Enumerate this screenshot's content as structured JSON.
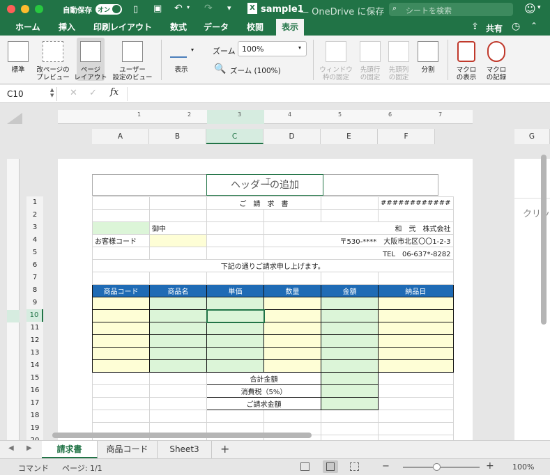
{
  "titlebar": {
    "autosave_label": "自動保存",
    "autosave_state": "オン",
    "title": "sample1",
    "title_suffix": "— OneDrive に保存",
    "search_placeholder": "シートを検索"
  },
  "tabs": [
    "ホーム",
    "挿入",
    "印刷レイアウト",
    "数式",
    "データ",
    "校閲",
    "表示"
  ],
  "share_label": "共有",
  "ribbon": {
    "normal": "標準",
    "pagebreak": "改ページの\nプレビュー",
    "pagelayout": "ページ\nレイアウト",
    "custom": "ユーザー\n設定のビュー",
    "show": "表示",
    "zoom_label": "ズーム",
    "zoom_value": "100%",
    "zoom100": "ズーム (100%)",
    "freeze": "ウィンドウ\n枠の固定",
    "freeze_row": "先頭行\nの固定",
    "freeze_col": "先頭列\nの固定",
    "split": "分割",
    "macro_view": "マクロ\nの表示",
    "macro_record": "マクロ\nの記録"
  },
  "formula": {
    "namebox": "C10",
    "fx": "fx",
    "value": ""
  },
  "columns": [
    "A",
    "B",
    "C",
    "D",
    "E",
    "F"
  ],
  "col_g": "G",
  "ruler_numbers": [
    "1",
    "2",
    "3",
    "4",
    "5",
    "6",
    "7"
  ],
  "header_add": "ヘッダーの追加",
  "right_page_text": "クリッ",
  "rows": [
    {
      "n": "1",
      "cells": [
        "",
        "",
        "ご　請　求　書",
        "",
        "",
        "############"
      ]
    },
    {
      "n": "2",
      "cells": [
        "",
        "",
        "",
        "",
        "",
        ""
      ]
    },
    {
      "n": "3",
      "cells": [
        "",
        "御中",
        "",
        "和　弐　株式会社",
        "",
        ""
      ]
    },
    {
      "n": "4",
      "cells": [
        "お客様コード",
        "",
        "",
        "〒530-****　大阪市北区〇〇1-2-3",
        "",
        ""
      ]
    },
    {
      "n": "5",
      "cells": [
        "",
        "",
        "",
        "TEL　06-637*-8282",
        "",
        ""
      ]
    },
    {
      "n": "6",
      "cells": [
        "",
        "",
        "下記の通りご請求申し上げます。",
        "",
        "",
        ""
      ]
    },
    {
      "n": "7",
      "cells": [
        "",
        "",
        "",
        "",
        "",
        ""
      ]
    },
    {
      "n": "8",
      "cells": [
        "商品コード",
        "商品名",
        "単価",
        "数量",
        "金額",
        "納品日"
      ]
    },
    {
      "n": "9",
      "cells": [
        "",
        "",
        "",
        "",
        "",
        ""
      ]
    },
    {
      "n": "10",
      "cells": [
        "",
        "",
        "",
        "",
        "",
        ""
      ]
    },
    {
      "n": "11",
      "cells": [
        "",
        "",
        "",
        "",
        "",
        ""
      ]
    },
    {
      "n": "12",
      "cells": [
        "",
        "",
        "",
        "",
        "",
        ""
      ]
    },
    {
      "n": "13",
      "cells": [
        "",
        "",
        "",
        "",
        "",
        ""
      ]
    },
    {
      "n": "14",
      "cells": [
        "",
        "",
        "",
        "",
        "",
        ""
      ]
    },
    {
      "n": "15",
      "cells": [
        "",
        "",
        "",
        "合計金額",
        "",
        ""
      ]
    },
    {
      "n": "16",
      "cells": [
        "",
        "",
        "",
        "消費税（5%）",
        "",
        ""
      ]
    },
    {
      "n": "17",
      "cells": [
        "",
        "",
        "",
        "ご請求金額",
        "",
        ""
      ]
    },
    {
      "n": "18",
      "cells": [
        "",
        "",
        "",
        "",
        "",
        ""
      ]
    },
    {
      "n": "19",
      "cells": [
        "",
        "",
        "",
        "",
        "",
        ""
      ]
    },
    {
      "n": "20",
      "cells": [
        "",
        "",
        "",
        "",
        "",
        ""
      ]
    }
  ],
  "sheets": [
    "請求書",
    "商品コード",
    "Sheet3"
  ],
  "add_sheet": "+",
  "status": {
    "mode": "コマンド",
    "page": "ページ: 1/1",
    "zoom": "100%",
    "minus": "−",
    "plus": "+"
  },
  "colors": {
    "accent": "#217346",
    "header_blue": "#1f6bb5",
    "yellow": "#fefed6",
    "green": "#dcf5d8"
  }
}
